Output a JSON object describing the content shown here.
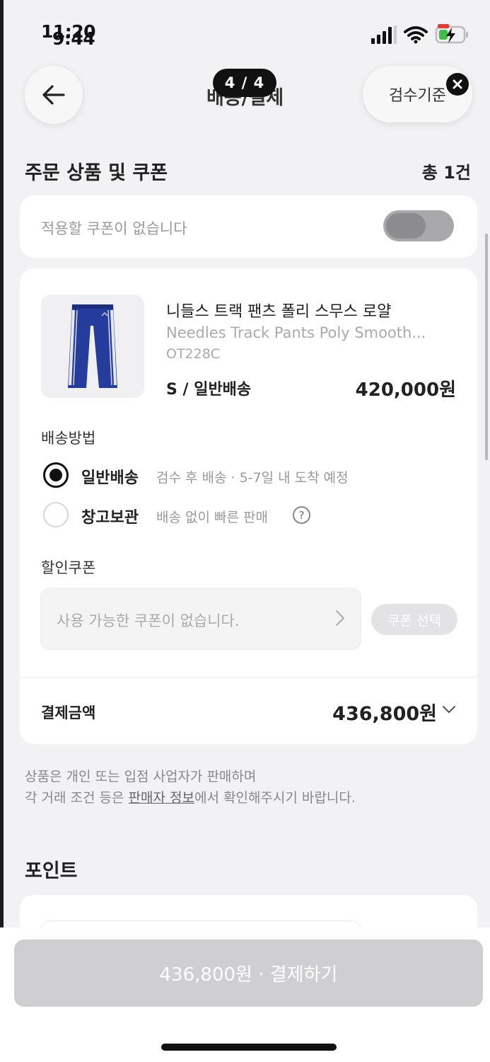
{
  "status_bar": {
    "time_prev": "11:20",
    "time": "9:44"
  },
  "header": {
    "title": "배송/결제",
    "page_indicator": "4 / 4",
    "inspect_label": "검수기준"
  },
  "order_section": {
    "title": "주문 상품 및 쿠폰",
    "count": "총 1건"
  },
  "coupon_toggle": {
    "text": "적용할 쿠폰이 없습니다",
    "enabled": false
  },
  "product": {
    "name_ko": "니들스 트랙 팬츠 폴리 스무스 로얄",
    "name_en": "Needles Track Pants Poly Smooth...",
    "code": "OT228C",
    "option": "S / 일반배송",
    "price": "420,000원",
    "image_icon": "track-pants-image"
  },
  "shipping": {
    "label": "배송방법",
    "options": [
      {
        "title": "일반배송",
        "desc": "검수 후 배송 · 5-7일 내 도착 예정",
        "selected": true
      },
      {
        "title": "창고보관",
        "desc": "배송 없이 빠른 판매",
        "selected": false
      }
    ],
    "help_icon": "?"
  },
  "discount_coupon": {
    "label": "할인쿠폰",
    "placeholder": "사용 가능한 쿠폰이 없습니다.",
    "button": "쿠폰 선택"
  },
  "payment": {
    "label": "결제금액",
    "amount": "436,800원"
  },
  "notice": {
    "line1": "상품은 개인 또는 입점 사업자가 판매하며",
    "line2_prefix": "각 거래 조건 등은 ",
    "line2_link": "판매자 정보",
    "line2_suffix": "에서 확인해주시기 바랍니다."
  },
  "points": {
    "title": "포인트"
  },
  "cta": {
    "label": "436,800원 · 결제하기"
  },
  "colors": {
    "primary_text": "#222222",
    "muted": "#9a9a9a",
    "disabled_button": "#cfcfd1",
    "background": "#f2f2f4"
  }
}
